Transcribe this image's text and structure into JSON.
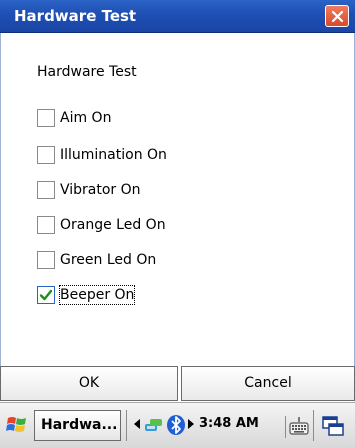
{
  "window": {
    "title": "Hardware Test",
    "heading": "Hardware Test"
  },
  "checkboxes": [
    {
      "label": "Aim On",
      "checked": false
    },
    {
      "label": "Illumination On",
      "checked": false
    },
    {
      "label": "Vibrator On",
      "checked": false
    },
    {
      "label": "Orange Led On",
      "checked": false
    },
    {
      "label": "Green Led On",
      "checked": false
    },
    {
      "label": "Beeper On",
      "checked": true
    }
  ],
  "buttons": {
    "ok": "OK",
    "cancel": "Cancel"
  },
  "taskbar": {
    "task_label": "Hardwa...",
    "clock": "3:48 AM"
  },
  "icons": {
    "close": "close-icon",
    "start": "windows-flag-icon",
    "network": "network-icon",
    "bluetooth": "bluetooth-icon",
    "keyboard": "keyboard-icon",
    "switcher": "window-switcher-icon"
  },
  "colors": {
    "titlebar": "#1f4fb3",
    "close_button": "#d84a2e",
    "checkmark": "#1a8f1a"
  }
}
